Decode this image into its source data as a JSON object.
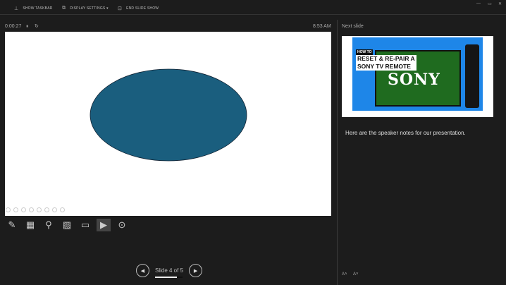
{
  "toolbar": {
    "show_taskbar": "SHOW TASKBAR",
    "display_settings": "DISPLAY SETTINGS ▾",
    "end_slide_show": "END SLIDE SHOW"
  },
  "window": {
    "minimize": "—",
    "restore": "▭",
    "close": "✕"
  },
  "timer": {
    "elapsed": "0:00:27",
    "pause": "⏸",
    "reset": "↻"
  },
  "clock": "8:53 AM",
  "current_slide": {
    "shape": "ellipse",
    "fill": "#1a5e7e"
  },
  "next_slide": {
    "label": "Next slide",
    "how_to": "HOW TO",
    "title_line1": "RESET & RE-PAIR A",
    "title_line2": "SONY TV REMOTE",
    "brand": "SONY"
  },
  "notes": "Here are the speaker notes for our presentation.",
  "navigation": {
    "slide_counter": "Slide 4 of 5",
    "current": 4,
    "total": 5,
    "prev": "◀",
    "next": "▶"
  },
  "font_controls": {
    "increase": "A˄",
    "decrease": "A˅"
  }
}
